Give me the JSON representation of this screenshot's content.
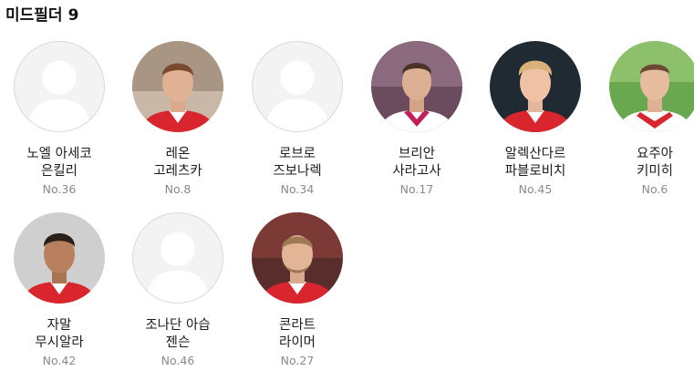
{
  "section": {
    "title": "미드필더",
    "count": "9"
  },
  "colors": {
    "placeholder_bg": "#f3f3f3",
    "placeholder_figure": "#ffffff",
    "jersey_red": "#d9262e"
  },
  "players": [
    {
      "line1": "노엘 아세코",
      "line2": "은킬리",
      "number": "No.36",
      "photo": "placeholder-icon"
    },
    {
      "line1": "레온",
      "line2": "고레츠카",
      "number": "No.8",
      "photo": "player-photo"
    },
    {
      "line1": "로브로",
      "line2": "즈보나렉",
      "number": "No.34",
      "photo": "placeholder-icon"
    },
    {
      "line1": "브리안",
      "line2": "사라고사",
      "number": "No.17",
      "photo": "player-photo"
    },
    {
      "line1": "알렉산다르",
      "line2": "파블로비치",
      "number": "No.45",
      "photo": "player-photo"
    },
    {
      "line1": "요주아",
      "line2": "키미히",
      "number": "No.6",
      "photo": "player-photo"
    },
    {
      "line1": "자말",
      "line2": "무시알라",
      "number": "No.42",
      "photo": "player-photo"
    },
    {
      "line1": "조나단 아습",
      "line2": "젠슨",
      "number": "No.46",
      "photo": "placeholder-icon"
    },
    {
      "line1": "콘라트",
      "line2": "라이머",
      "number": "No.27",
      "photo": "player-photo"
    }
  ]
}
